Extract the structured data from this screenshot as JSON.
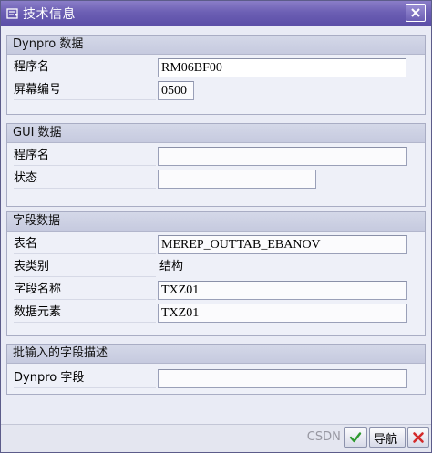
{
  "window": {
    "title": "技术信息",
    "title_icon": "info-window-icon",
    "close_icon": "close-icon"
  },
  "dynpro": {
    "header": "Dynpro 数据",
    "program_label": "程序名",
    "program_value": "RM06BF00",
    "screen_label": "屏幕编号",
    "screen_value": "0500"
  },
  "gui": {
    "header": "GUI 数据",
    "program_label": "程序名",
    "program_value": "",
    "status_label": "状态",
    "status_value": ""
  },
  "field_data": {
    "header": "字段数据",
    "table_label": "表名",
    "table_value": "MEREP_OUTTAB_EBANOV",
    "table_type_label": "表类别",
    "table_type_value": "结构",
    "field_name_label": "字段名称",
    "field_name_value": "TXZ01",
    "data_element_label": "数据元素",
    "data_element_value": "TXZ01"
  },
  "batch": {
    "header": "批输入的字段描述",
    "dynpro_field_label": "Dynpro 字段",
    "dynpro_field_value": ""
  },
  "footer": {
    "confirm_icon": "checkmark-icon",
    "nav_label": "导航",
    "cancel_icon": "cancel-icon",
    "watermark": "CSDN @"
  },
  "colors": {
    "titlebar": "#6c5fb4",
    "focus_corners": "#e0203a",
    "confirm_green": "#2f9a2f",
    "cancel_red": "#d42a2a"
  }
}
